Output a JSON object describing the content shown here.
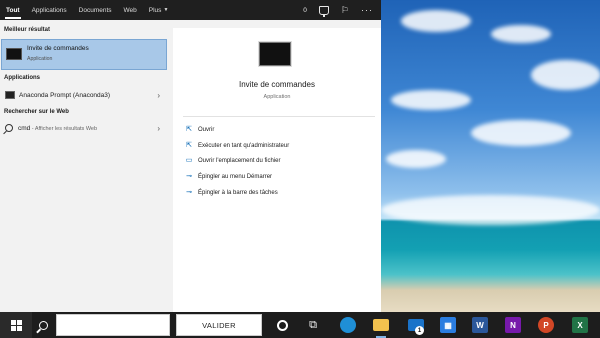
{
  "tabs": [
    {
      "label": "Tout",
      "active": true
    },
    {
      "label": "Applications"
    },
    {
      "label": "Documents"
    },
    {
      "label": "Web"
    },
    {
      "label": "Plus"
    }
  ],
  "tabbar_right": {
    "points": "0"
  },
  "left": {
    "best_match_heading": "Meilleur résultat",
    "best_match": {
      "title": "Invite de commandes",
      "subtitle": "Application"
    },
    "apps_heading": "Applications",
    "apps": [
      {
        "label": "Anaconda Prompt (Anaconda3)"
      }
    ],
    "web_heading": "Rechercher sur le Web",
    "web_query": "cmd",
    "web_hint": " - Afficher les résultats Web"
  },
  "detail": {
    "title": "Invite de commandes",
    "subtitle": "Application",
    "actions": [
      {
        "label": "Ouvrir",
        "icon": "open-icon"
      },
      {
        "label": "Exécuter en tant qu'administrateur",
        "icon": "run-as-admin-icon"
      },
      {
        "label": "Ouvrir l'emplacement du fichier",
        "icon": "file-location-icon"
      },
      {
        "label": "Épingler au menu Démarrer",
        "icon": "pin-start-icon"
      },
      {
        "label": "Épingler à la barre des tâches",
        "icon": "pin-taskbar-icon"
      }
    ]
  },
  "taskbar": {
    "valider_label": "VALIDER",
    "mail_badge": "1",
    "apps": [
      {
        "name": "edge",
        "color": "#1f8fd6"
      },
      {
        "name": "file-explorer",
        "color": "#f2c14e"
      },
      {
        "name": "mail",
        "color": "#1a73c9"
      },
      {
        "name": "store",
        "color": "#2b7de0"
      },
      {
        "name": "word",
        "letter": "W",
        "color": "#2b579a"
      },
      {
        "name": "onenote",
        "letter": "N",
        "color": "#7719aa"
      },
      {
        "name": "powerpoint",
        "letter": "P",
        "color": "#d24726"
      },
      {
        "name": "excel",
        "letter": "X",
        "color": "#217346"
      }
    ]
  }
}
